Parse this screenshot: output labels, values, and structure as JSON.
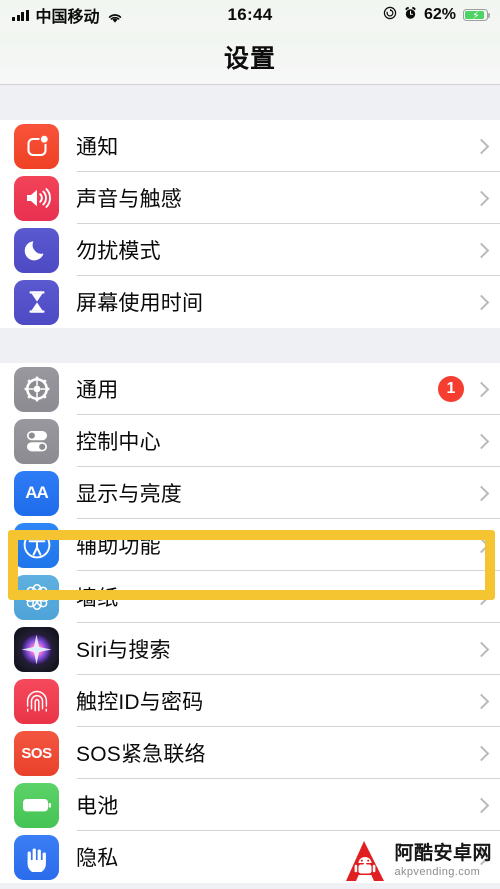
{
  "status_bar": {
    "carrier": "中国移动",
    "wifi_icon": "wifi-icon",
    "signal_icon": "signal-bars-icon",
    "time": "16:44",
    "rotation_lock_icon": "rotation-lock-icon",
    "alarm_icon": "alarm-clock-icon",
    "battery_percent": "62%",
    "battery_icon": "battery-charging-icon"
  },
  "nav": {
    "title": "设置"
  },
  "groups": [
    {
      "rows": [
        {
          "label": "通知",
          "icon": "notifications-icon",
          "icon_class": "ic-notify",
          "badge": null
        },
        {
          "label": "声音与触感",
          "icon": "sound-haptics-icon",
          "icon_class": "ic-sound",
          "badge": null
        },
        {
          "label": "勿扰模式",
          "icon": "do-not-disturb-moon-icon",
          "icon_class": "ic-dnd",
          "badge": null
        },
        {
          "label": "屏幕使用时间",
          "icon": "screen-time-hourglass-icon",
          "icon_class": "ic-screen",
          "badge": null
        }
      ]
    },
    {
      "rows": [
        {
          "label": "通用",
          "icon": "general-gear-icon",
          "icon_class": "ic-general",
          "badge": "1"
        },
        {
          "label": "控制中心",
          "icon": "control-center-toggles-icon",
          "icon_class": "ic-control",
          "badge": null
        },
        {
          "label": "显示与亮度",
          "icon": "display-brightness-aa-icon",
          "icon_class": "ic-display",
          "badge": null
        },
        {
          "label": "辅助功能",
          "icon": "accessibility-icon",
          "icon_class": "ic-access",
          "badge": null
        },
        {
          "label": "墙纸",
          "icon": "wallpaper-flower-icon",
          "icon_class": "ic-wall",
          "badge": null
        },
        {
          "label": "Siri与搜索",
          "icon": "siri-search-icon",
          "icon_class": "ic-siri",
          "badge": null
        },
        {
          "label": "触控ID与密码",
          "icon": "touch-id-fingerprint-icon",
          "icon_class": "ic-touch",
          "badge": null
        },
        {
          "label": "SOS紧急联络",
          "icon": "emergency-sos-icon",
          "icon_class": "ic-sos",
          "badge": null
        },
        {
          "label": "电池",
          "icon": "battery-icon",
          "icon_class": "ic-battery",
          "badge": null
        },
        {
          "label": "隐私",
          "icon": "privacy-hand-icon",
          "icon_class": "ic-privacy",
          "badge": null
        }
      ]
    }
  ],
  "highlight": {
    "target_label": "辅助功能",
    "color": "#f5c531"
  },
  "watermark": {
    "site_name": "阿酷安卓网",
    "url": "akpvending.com",
    "logo_color": "#e02020"
  },
  "colors": {
    "group_background": "#eff0f4",
    "row_background": "#ffffff",
    "separator": "#d3d3d6",
    "badge_red": "#f53e30",
    "chevron": "#b9b9be"
  }
}
